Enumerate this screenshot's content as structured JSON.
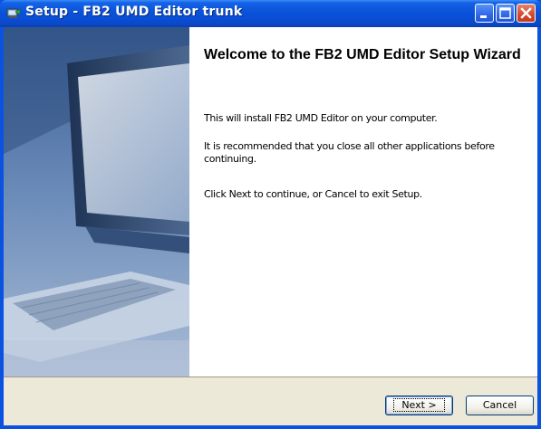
{
  "window": {
    "title": "Setup - FB2 UMD Editor trunk",
    "app_icon": "setup-installer-icon",
    "controls": [
      "minimize-icon",
      "maximize-icon",
      "close-icon"
    ]
  },
  "content": {
    "heading": "Welcome to the FB2 UMD Editor Setup Wizard",
    "paragraphs": [
      "This will install FB2 UMD Editor on your computer.",
      "It is recommended that you close all other applications before continuing.",
      "Click Next to continue, or Cancel to exit Setup."
    ]
  },
  "buttons": {
    "next_label": "Next >",
    "cancel_label": "Cancel"
  },
  "colors": {
    "titlebar": "#0a52d9",
    "close_button": "#d3492b",
    "button_face": "#ece9d8"
  }
}
